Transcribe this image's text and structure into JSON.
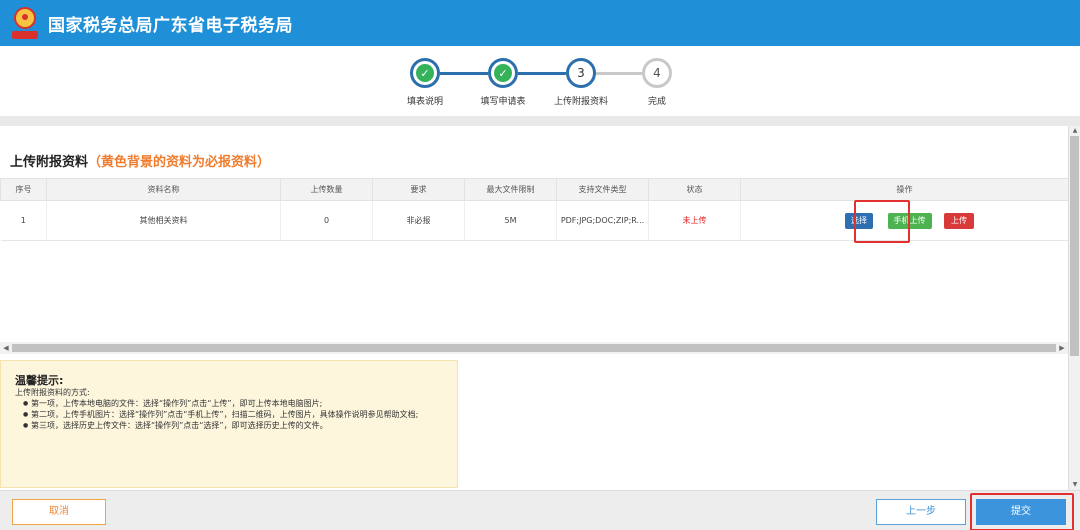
{
  "header": {
    "title": "国家税务总局广东省电子税务局"
  },
  "stepper": {
    "steps": [
      {
        "number": "1",
        "label": "填表说明",
        "done": true
      },
      {
        "number": "2",
        "label": "填写申请表",
        "done": true
      },
      {
        "number": "3",
        "label": "上传附报资料",
        "done": false
      },
      {
        "number": "4",
        "label": "完成",
        "done": false
      }
    ]
  },
  "section": {
    "title": "上传附报资料",
    "required_note": "（黄色背景的资料为必报资料）"
  },
  "table": {
    "headers": [
      "序号",
      "资料名称",
      "上传数量",
      "要求",
      "最大文件限制",
      "支持文件类型",
      "状态",
      "操作"
    ],
    "rows": [
      {
        "index": "1",
        "name": "其他相关资料",
        "count": "0",
        "requirement": "非必报",
        "max_size": "5M",
        "file_types": "PDF;JPG;DOC;ZIP;R...",
        "status": "未上传",
        "actions": {
          "select": "选择",
          "mobile_upload": "手机上传",
          "upload": "上传"
        }
      }
    ]
  },
  "tips": {
    "title": "温馨提示:",
    "intro": "上传附报资料的方式:",
    "items": [
      "第一项，上传本地电脑的文件：选择“操作列”点击“上传”，即可上传本地电脑图片;",
      "第二项，上传手机图片：选择“操作列”点击“手机上传”，扫描二维码，上传图片，具体操作说明参见帮助文档;",
      "第三项，选择历史上传文件：选择“操作列”点击“选择”，即可选择历史上传的文件。"
    ]
  },
  "footer": {
    "cancel": "取消",
    "prev": "上一步",
    "submit": "提交"
  },
  "colors": {
    "brand": "#1f8fd8",
    "step_active": "#2b6fad",
    "done_check": "#35b35a",
    "status_error": "#e02020",
    "highlight": "#e23030"
  }
}
